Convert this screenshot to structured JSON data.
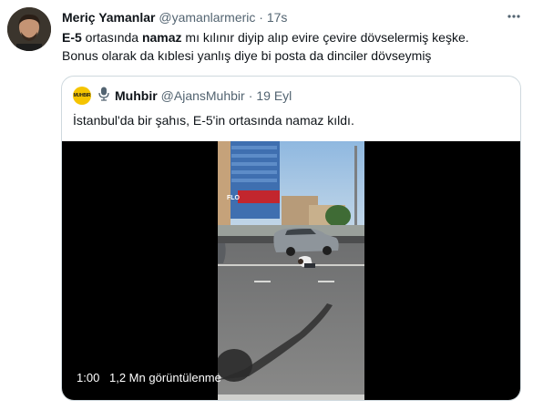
{
  "tweet": {
    "author_name": "Meriç Yamanlar",
    "author_handle": "@yamanlarmeric",
    "separator": "·",
    "time": "17s",
    "text_bold_1": "E-5",
    "text_part_1": " ortasında ",
    "text_bold_2": "namaz",
    "text_part_2": " mı kılınır diyip alıp evire çevire dövselermiş keşke.",
    "text_line_2": "Bonus olarak da kıblesi yanlış diye bi posta da dinciler dövseymiş"
  },
  "quoted_tweet": {
    "author_name": "Muhbir",
    "author_handle": "@AjansMuhbir",
    "separator": "·",
    "date": "19 Eyl",
    "text": "İstanbul'da bir şahıs, E-5'in ortasında namaz kıldı.",
    "video": {
      "duration": "1:00",
      "views": "1,2 Mn görüntülenme",
      "sign_text": "FLO"
    }
  },
  "icons": {
    "more": "more-horizontal-icon",
    "mic": "microphone-icon"
  },
  "colors": {
    "text": "#0f1419",
    "muted": "#536471",
    "border": "#cfd9de",
    "avatar_badge": "#f5c400"
  }
}
